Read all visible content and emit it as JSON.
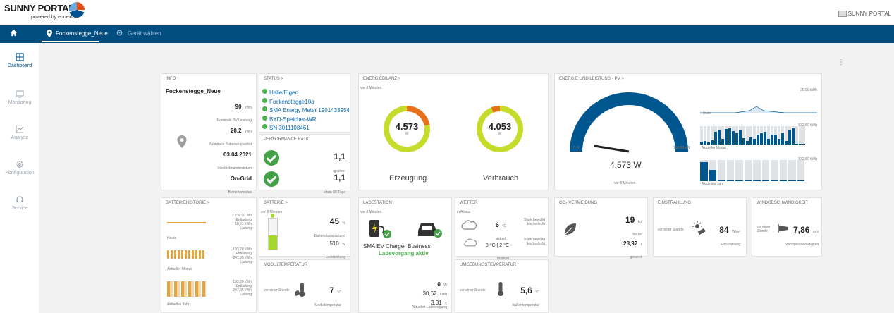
{
  "header": {
    "logo_title": "SUNNY PORTAL",
    "logo_sub": "powered by ennexOS",
    "right_label": "SUNNY PORTAL"
  },
  "nav": {
    "location": "Fockenstegge_Neue",
    "device_select": "Gerät wählen"
  },
  "sidebar": [
    {
      "label": "Dashboard",
      "icon": "dashboard-icon"
    },
    {
      "label": "Monitoring",
      "icon": "monitor-icon"
    },
    {
      "label": "Analyse",
      "icon": "chart-icon"
    },
    {
      "label": "Konfiguration",
      "icon": "gear-icon"
    },
    {
      "label": "Service",
      "icon": "headset-icon"
    }
  ],
  "info": {
    "title": "INFO",
    "name": "Fockenstegge_Neue",
    "power_val": "90",
    "power_unit": "kWp",
    "power_lbl": "Nominale PV Leistung",
    "bat_val": "20.2",
    "bat_unit": "kWh",
    "bat_lbl": "Nominale Batteriekapazität",
    "date_val": "03.04.2021",
    "date_lbl": "Inbetriebnahmedatum",
    "mode_val": "On-Grid",
    "mode_lbl": "Betriebsmodus"
  },
  "status": {
    "title": "STATUS >",
    "items": [
      "Halle/Eigen",
      "Fockenstegge10a",
      "SMA Energy Meter 1901433954",
      "BYD-Speicher-WR",
      "SN 3011108461"
    ]
  },
  "performance": {
    "title": "PERFORMANCE RATIO",
    "v1": "1,1",
    "l1": "gestern",
    "v2": "1,1",
    "l2": "letzte 30 Tage"
  },
  "energiebilanz": {
    "title": "ENERGIEBILANZ >",
    "time": "vor 8 Minuten",
    "gen_val": "4.573",
    "gen_unit": "W",
    "gen_lbl": "Erzeugung",
    "con_val": "4.053",
    "con_unit": "W",
    "con_lbl": "Verbrauch"
  },
  "energie_pv": {
    "title": "ENERGIE UND LEISTUNG - PV >",
    "gauge_val": "4.573 W",
    "gauge_min": "0 W",
    "gauge_max": "100,00 kW",
    "time": "vor 8 Minuten",
    "gauge_level": 0.05,
    "charts": [
      {
        "max": "29,90 kWh",
        "label": "Heute"
      },
      {
        "max": "832,50 kWh",
        "label": "Aktueller Monat"
      },
      {
        "max": "832,50 kWh",
        "label": "Aktuelles Jahr"
      }
    ],
    "month_bars": [
      0.15,
      0.2,
      0.12,
      0.25,
      0.7,
      0.8,
      0.3,
      0.85,
      0.9,
      0.75,
      0.6,
      0.8,
      0.35,
      0.2,
      0.4,
      0.3,
      0.55,
      0.6,
      0.7,
      0.3,
      0.55,
      0.5,
      0.3,
      0.6,
      0.2,
      0.8,
      0.9,
      0.05,
      0.05,
      0.05
    ],
    "year_bars": [
      0.9,
      0.55,
      0.05,
      0.05,
      0.05,
      0.05,
      0.05,
      0.05,
      0.05,
      0.05,
      0.05,
      0.05
    ]
  },
  "batteriehistorie": {
    "title": "BATTERIEHISTORIE >",
    "rows": [
      {
        "l1": "2.336,00 Wh",
        "l2": "Entladung",
        "l3": "10,51 kWh",
        "l4": "Ladung",
        "label": "Heute"
      },
      {
        "l1": "193,20 kWh",
        "l2": "Entladung",
        "l3": "247,95 kWh",
        "l4": "Ladung",
        "label": "Aktueller Monat"
      },
      {
        "l1": "193,20 kWh",
        "l2": "Entladung",
        "l3": "247,95 kWh",
        "l4": "Ladung",
        "label": "Aktuelles Jahr"
      }
    ]
  },
  "batterie": {
    "title": "BATTERIE >",
    "time": "vor 8 Minuten",
    "soc_val": "45",
    "soc_unit": "%",
    "soc_lbl": "Batterieladezustand",
    "soc_level": 0.45,
    "power_val": "510",
    "power_unit": "W",
    "power_lbl": "Ladeleistung"
  },
  "modultemp": {
    "title": "MODULTEMPERATUR",
    "period": "vor einer Stunde",
    "val": "7",
    "unit": "°C",
    "lbl": "Modultemperatur"
  },
  "ladestation": {
    "title": "LADESTATION",
    "time": "vor 8 Minuten",
    "name": "SMA EV Charger Business",
    "state": "Ladevorgang aktiv",
    "v1": "0",
    "u1": "W",
    "v2": "30,62",
    "u2": "kWh",
    "v3": "3,31",
    "u3": "€",
    "lbl": "Aktueller Ladevorgang"
  },
  "wetter": {
    "title": "WETTER",
    "loc": "in Ahaus",
    "t1": "6",
    "u1": "°C",
    "l1": "aktuell",
    "d1a": "Stark bewölkt",
    "d1b": "bis bedeckt",
    "t2": "8 °C | 2 °C",
    "l2": "morgen",
    "d2a": "Stark bewölkt",
    "d2b": "bis bedeckt"
  },
  "umgebung": {
    "title": "UMGEBUNGSTEMPERATUR",
    "period": "vor einer Stunde",
    "val": "5,6",
    "unit": "°C",
    "lbl": "Außentemperatur"
  },
  "co2": {
    "title": "CO₂-VERMEIDUNG",
    "v1": "19",
    "u1": "kg",
    "l1": "heute",
    "v2": "23,97",
    "u2": "t",
    "l2": "gesamt"
  },
  "einstrahlung": {
    "title": "EINSTRAHLUNG",
    "period": "vor einer Stunde",
    "val": "84",
    "unit": "W/m²",
    "lbl": "Einstrahlung"
  },
  "wind": {
    "title": "WINDGESCHWINDIGKEIT",
    "period_a": "vor einer",
    "period_b": "Stunde",
    "val": "7,86",
    "unit": "m/s",
    "lbl": "Windgeschwindigkeit"
  },
  "colors": {
    "primary": "#004d80",
    "green": "#4caf50",
    "donut": "#c6dc2c",
    "orange": "#e8711c"
  }
}
